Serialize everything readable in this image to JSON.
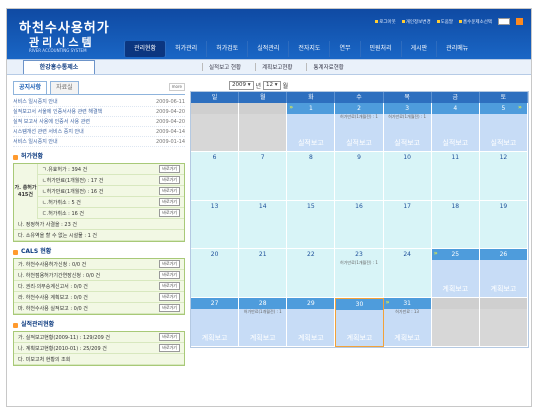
{
  "header": {
    "logo_line1": "하천수사용허가",
    "logo_line2": "관리시스템",
    "logo_sub": "RIVER ACCOUNTING SYSTEM",
    "util_links": [
      "로그아웃",
      "개인정보변경",
      "도움말",
      "홈수운제소선택"
    ],
    "nav": [
      "관리현황",
      "허가관리",
      "허가검토",
      "실적관리",
      "전자지도",
      "연무",
      "민원처리",
      "게시판",
      "관리메뉴"
    ],
    "user_office": "한강홍수통제소"
  },
  "subnav": [
    "실적보고 현황",
    "계획보고현황",
    "통계자료현황"
  ],
  "notice": {
    "tabs": [
      "공지사항",
      "자료실"
    ],
    "more": "more",
    "items": [
      {
        "title": "서비스 일시중지 안내",
        "date": "2009-06-11"
      },
      {
        "title": "실적보고서 서울에 인증서사용 관련 해결책",
        "date": "2009-04-20"
      },
      {
        "title": "실적 보고서 사용에 인증서 사용 관련",
        "date": "2009-04-20"
      },
      {
        "title": "시스템개선 관련 서비스 중지 안내",
        "date": "2009-04-14"
      },
      {
        "title": "서비스 일시중지 안내",
        "date": "2009-01-14"
      }
    ]
  },
  "permit_status": {
    "title": "허가현황",
    "group_label": "가. 총허가 415건",
    "rows": [
      {
        "label": "ㄱ.유효허가 : 394 건",
        "btn": "바로가기"
      },
      {
        "label": "ㄴ허가만료(1개월전) : 17 건",
        "btn": "바로가기"
      },
      {
        "label": "ㄴ허가만료(1개월전) : 16 건",
        "btn": "바로가기"
      },
      {
        "label": "ㄴ.허가취소 : 5 건",
        "btn": "바로가기"
      },
      {
        "label": "ㄷ.허가취소 : 16 건",
        "btn": "바로가기"
      }
    ],
    "extra": [
      "나. 정정허가 사결을 : 23 건",
      "다. 소유역을 할 수 없는 시설물 : 1 건"
    ]
  },
  "cals_status": {
    "title": "CALS 현황",
    "rows": [
      {
        "label": "가. 하천수사용허가신청 : 0/0 건",
        "btn": "바로가기"
      },
      {
        "label": "나. 하천점용허가기간연장신청 : 0/0 건",
        "btn": "바로가기"
      },
      {
        "label": "다. 권리·의무승계신고서 : 0/0 건",
        "btn": "바로가기"
      },
      {
        "label": "라. 하천수사용 계획보고 : 0/0 건",
        "btn": "바로가기"
      },
      {
        "label": "마. 하천수사용 실적보고 : 0/0 건",
        "btn": "바로가기"
      }
    ]
  },
  "perf_status": {
    "title": "실적관리현황",
    "rows": [
      {
        "label": "가. 실적보고현황(2009-11) : 129/209 건",
        "btn": "바로가기"
      },
      {
        "label": "나. 계획보고현황(2010-01) : 25/209 건",
        "btn": "바로가기"
      },
      {
        "label": "다. 미보고처 현황의 조회",
        "btn": ""
      }
    ]
  },
  "calendar": {
    "year": "2009",
    "year_unit": "년",
    "month": "12",
    "month_unit": "월",
    "weekdays": [
      "일",
      "월",
      "화",
      "수",
      "목",
      "금",
      "토"
    ],
    "weeks": [
      [
        {
          "n": ""
        },
        {
          "n": ""
        },
        {
          "n": "1",
          "hl": true
        },
        {
          "n": "2",
          "hl": true,
          "sub": "허가만료(1개월전) : 1"
        },
        {
          "n": "3",
          "hl": true,
          "sub": "허가만료(1개월전) : 1"
        },
        {
          "n": "4",
          "hl": true
        },
        {
          "n": "5",
          "hl": true
        }
      ],
      [
        {
          "n": "6"
        },
        {
          "n": "7"
        },
        {
          "n": "8"
        },
        {
          "n": "9"
        },
        {
          "n": "10"
        },
        {
          "n": "11"
        },
        {
          "n": "12"
        }
      ],
      [
        {
          "n": "13"
        },
        {
          "n": "14"
        },
        {
          "n": "15"
        },
        {
          "n": "16"
        },
        {
          "n": "17"
        },
        {
          "n": "18"
        },
        {
          "n": "19"
        }
      ],
      [
        {
          "n": "20"
        },
        {
          "n": "21"
        },
        {
          "n": "22"
        },
        {
          "n": "23",
          "sub": "허가만료(1개월전) : 1"
        },
        {
          "n": "24"
        },
        {
          "n": "25",
          "hl": true
        },
        {
          "n": "26",
          "hl": true
        }
      ],
      [
        {
          "n": "27",
          "hl": true
        },
        {
          "n": "28",
          "hl": true,
          "sub": "허가만료(1개월전) : 1"
        },
        {
          "n": "29",
          "hl": true
        },
        {
          "n": "30",
          "hl": true
        },
        {
          "n": "31",
          "hl": true,
          "sub": "허가만료 : 13"
        },
        {
          "n": ""
        },
        {
          "n": ""
        }
      ]
    ],
    "event_label_report": "실적보고",
    "event_label_plan": "계획보고"
  }
}
